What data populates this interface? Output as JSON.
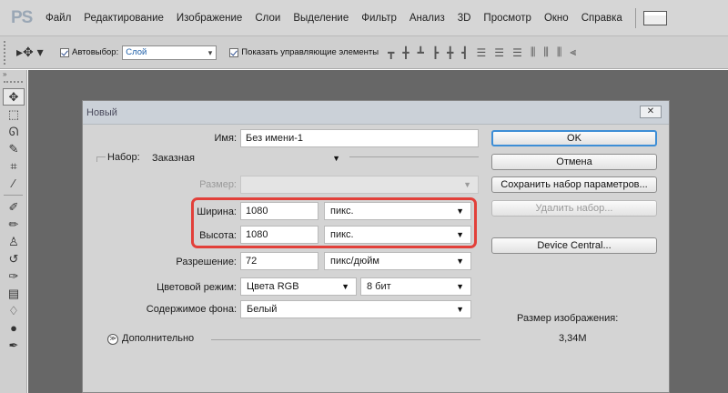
{
  "app": {
    "logo": "PS"
  },
  "menu": [
    "Файл",
    "Редактирование",
    "Изображение",
    "Слои",
    "Выделение",
    "Фильтр",
    "Анализ",
    "3D",
    "Просмотр",
    "Окно",
    "Справка"
  ],
  "options": {
    "autoselect_label": "Автовыбор:",
    "autoselect_value": "Слой",
    "show_controls_label": "Показать управляющие элементы"
  },
  "dialog": {
    "title": "Новый",
    "close": "✕",
    "name_label": "Имя:",
    "name_value": "Без имени-1",
    "preset_label": "Набор:",
    "preset_value": "Заказная",
    "size_label": "Размер:",
    "width_label": "Ширина:",
    "width_value": "1080",
    "width_unit": "пикс.",
    "height_label": "Высота:",
    "height_value": "1080",
    "height_unit": "пикс.",
    "resolution_label": "Разрешение:",
    "resolution_value": "72",
    "resolution_unit": "пикс/дюйм",
    "color_mode_label": "Цветовой режим:",
    "color_mode_value": "Цвета RGB",
    "bit_depth_value": "8 бит",
    "background_label": "Содержимое фона:",
    "background_value": "Белый",
    "advanced_label": "Дополнительно",
    "buttons": {
      "ok": "OK",
      "cancel": "Отмена",
      "save_preset": "Сохранить набор параметров...",
      "delete_preset": "Удалить набор...",
      "device_central": "Device Central..."
    },
    "image_size_label": "Размер изображения:",
    "image_size_value": "3,34М"
  }
}
